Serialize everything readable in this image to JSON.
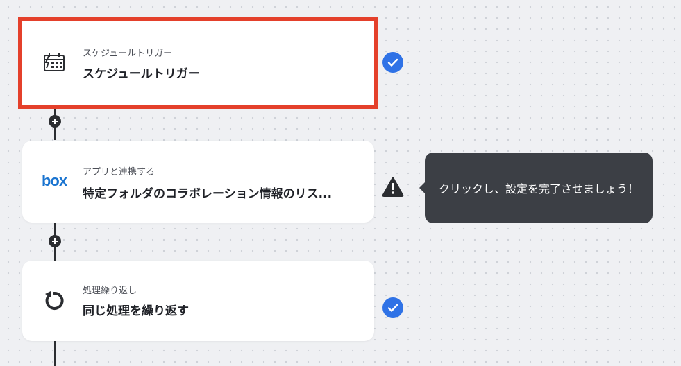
{
  "flow": {
    "steps": [
      {
        "label": "スケジュールトリガー",
        "title": "スケジュールトリガー",
        "icon": "schedule-calendar-icon",
        "status": "complete",
        "selected": true
      },
      {
        "label": "アプリと連携する",
        "title": "特定フォルダのコラボレーション情報のリス...",
        "icon": "box-logo",
        "logo_text": "box",
        "status": "warning",
        "selected": false
      },
      {
        "label": "処理繰り返し",
        "title": "同じ処理を繰り返す",
        "icon": "loop-icon",
        "status": "complete",
        "selected": false
      }
    ]
  },
  "tooltip": {
    "text": "クリックし、設定を完了させましょう！"
  },
  "colors": {
    "selection_border": "#e4402b",
    "check_badge": "#2f72e6",
    "tooltip_bg": "#3c3f45",
    "box_brand": "#1a74d0",
    "connector": "#2b2d31"
  }
}
